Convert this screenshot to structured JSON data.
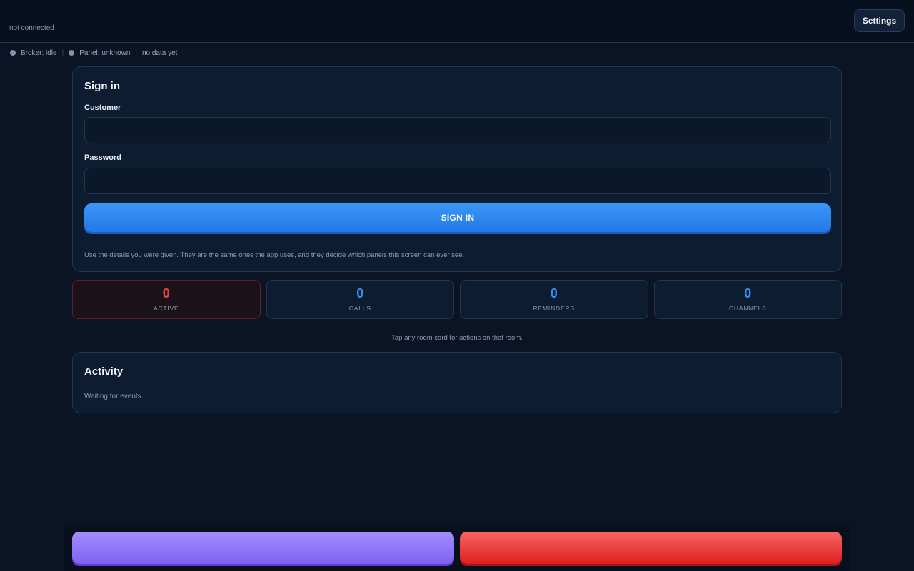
{
  "header": {
    "connection_status": "not connected",
    "settings_label": "Settings"
  },
  "status": {
    "broker": "Broker: idle",
    "panel": "Panel: unknown",
    "data": "no data yet"
  },
  "signin": {
    "title": "Sign in",
    "customer_label": "Customer",
    "customer_value": "",
    "password_label": "Password",
    "password_value": "",
    "button_label": "SIGN IN",
    "hint": "Use the details you were given. They are the same ones the app uses, and they decide which panels this screen can ever see."
  },
  "stats": [
    {
      "value": "0",
      "label": "ACTIVE",
      "color": "#ef4444"
    },
    {
      "value": "0",
      "label": "CALLS",
      "color": "#3b8ef0"
    },
    {
      "value": "0",
      "label": "REMINDERS",
      "color": "#3b8ef0"
    },
    {
      "value": "0",
      "label": "CHANNELS",
      "color": "#3b8ef0"
    }
  ],
  "room_hint": "Tap any room card for actions on that room.",
  "activity": {
    "title": "Activity",
    "status": "Waiting for events."
  },
  "colors": {
    "accent": "#2f86f0",
    "purple_action": "#8b72f8",
    "red_action": "#ea3b3b",
    "background": "#0a1424"
  }
}
